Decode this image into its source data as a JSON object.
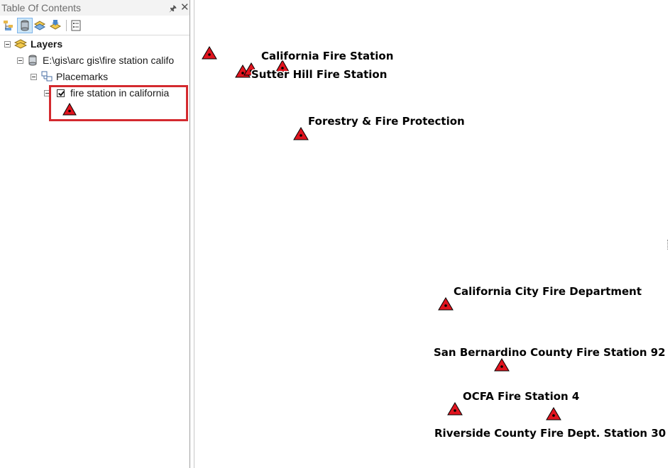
{
  "toc": {
    "title": "Table Of Contents",
    "toolbar": {
      "buttons": [
        "list-by-drawing-order",
        "list-by-source",
        "list-by-visibility",
        "list-by-selection",
        "options"
      ]
    },
    "tree": {
      "layers_label": "Layers",
      "source_label": "E:\\gis\\arc gis\\fire station califo",
      "group_label": "Placemarks",
      "layer_label": "fire station in california",
      "layer_checked": true
    }
  },
  "colors": {
    "symbol_fill": "#e0141e",
    "highlight": "#d42a2f",
    "label_halo": "#ffffff"
  },
  "map": {
    "labels": [
      "California Fire Station",
      "Sutter Hill Fire Station",
      "Forestry & Fire Protection",
      "California City Fire Department",
      "San Bernardino County Fire Station 92",
      "OCFA Fire Station 4",
      "Riverside County Fire Dept. Station 30"
    ]
  }
}
